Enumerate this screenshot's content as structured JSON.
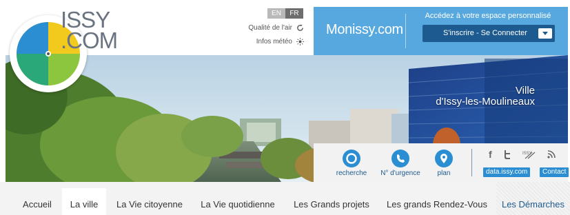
{
  "logo": {
    "line1": "ISSY",
    "line2": ".COM"
  },
  "languages": {
    "en": "EN",
    "fr": "FR"
  },
  "utilities": {
    "air_quality": "Qualité de l'air",
    "weather": "Infos météo"
  },
  "monissy": {
    "brand": "Monissy.com",
    "prompt": "Accédez à votre espace personnalisé",
    "login_label": "S'inscrire - Se Connecter",
    "background": "#57a8de",
    "button_color": "#1d5a8f"
  },
  "banner": {
    "ville_line1": "Ville",
    "ville_line2": "d'Issy-les-Moulineaux"
  },
  "toolbox": {
    "search_label": "recherche",
    "emergency_label": "N° d'urgence",
    "map_label": "plan",
    "social": [
      "f",
      "twitter",
      "ISSY TV",
      "rss"
    ],
    "data_link": "data.issy.com",
    "contact_link": "Contact",
    "accent": "#2b8ed3"
  },
  "nav": {
    "items": [
      "Accueil",
      "La ville",
      "La Vie citoyenne",
      "La Vie quotidienne",
      "Les Grands projets",
      "Les grands Rendez-Vous",
      "Les Démarches"
    ],
    "active_index": 1
  }
}
